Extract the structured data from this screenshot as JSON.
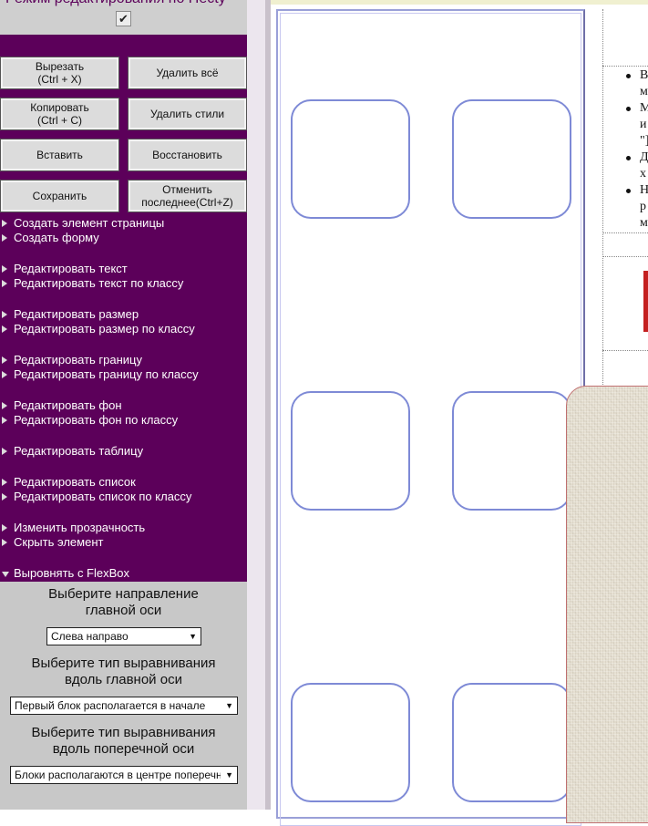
{
  "header": {
    "title": "Режим редактирования по Hecty",
    "toggle_glyph": "✔"
  },
  "buttons": {
    "cut": [
      "Вырезать",
      "(Ctrl + X)"
    ],
    "delete_all": "Удалить всё",
    "copy": [
      "Копировать",
      "(Ctrl + C)"
    ],
    "delete_styles": "Удалить стили",
    "paste": "Вставить",
    "restore": "Восстановить",
    "save": "Сохранить",
    "undo": [
      "Отменить",
      "последнее(Ctrl+Z)"
    ]
  },
  "menu": {
    "create_element": "Создать элемент страницы",
    "create_form": "Создать форму",
    "edit_text": "Редактировать текст",
    "edit_text_class": "Редактировать текст по классу",
    "edit_size": "Редактировать размер",
    "edit_size_class": "Редактировать размер по классу",
    "edit_border": "Редактировать границу",
    "edit_border_class": "Редактировать границу по классу",
    "edit_bg": "Редактировать фон",
    "edit_bg_class": "Редактировать фон по классу",
    "edit_table": "Редактировать таблицу",
    "edit_list": "Редактировать список",
    "edit_list_class": "Редактировать список по классу",
    "change_opacity": "Изменить прозрачность",
    "hide_element": "Скрыть элемент",
    "flexbox": "Выровнять с FlexBox"
  },
  "flexbox": {
    "main_dir_label": [
      "Выберите направление",
      "главной оси"
    ],
    "main_dir_value": "Слева направо",
    "main_align_label": [
      "Выберите тип выравнивания",
      "вдоль главной оси"
    ],
    "main_align_value": "Первый блок располагается в начале",
    "cross_align_label": [
      "Выберите тип выравнивания",
      "вдоль поперечной оси"
    ],
    "cross_align_value": "Блоки располагаются в центре поперечной оси",
    "arrow_glyph": "▼"
  },
  "content": {
    "list_lines": [
      "В",
      "м",
      "М",
      "и",
      "\"]",
      "Д",
      "х",
      "Н",
      "р",
      "м"
    ]
  },
  "colors": {
    "panel_bg": "#5c005a",
    "card_border": "#7e8ad6",
    "accent_red": "#c42020"
  }
}
